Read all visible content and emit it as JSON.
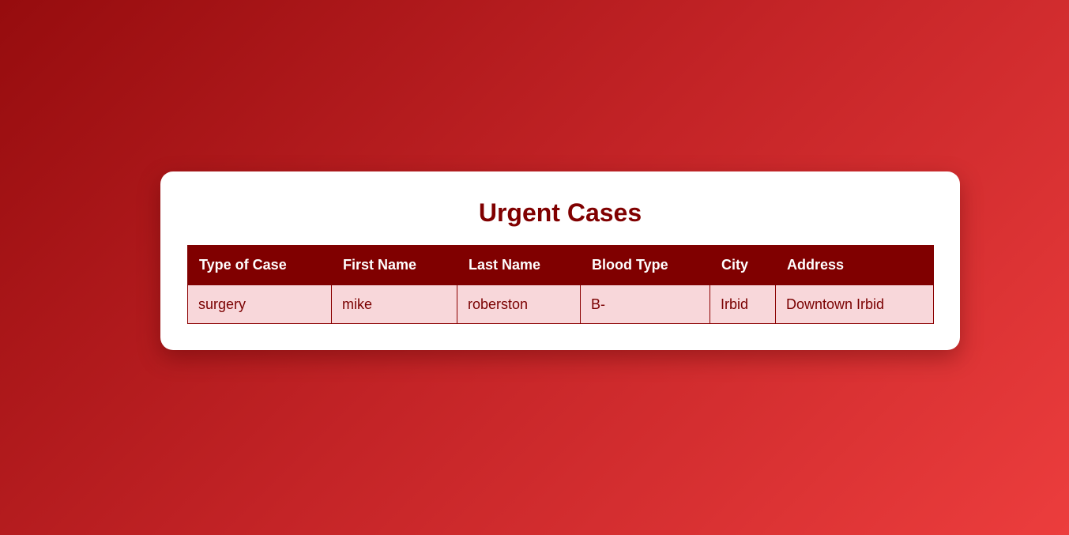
{
  "page": {
    "title": "Urgent Cases"
  },
  "table": {
    "headers": [
      "Type of Case",
      "First Name",
      "Last Name",
      "Blood Type",
      "City",
      "Address"
    ],
    "rows": [
      [
        "surgery",
        "mike",
        "roberston",
        "B-",
        "Irbid",
        "Downtown Irbid"
      ]
    ]
  },
  "colors": {
    "accent": "#800000",
    "row_background": "#f8d7da",
    "background_start": "#960c0e",
    "background_end": "#ec3d3d"
  }
}
